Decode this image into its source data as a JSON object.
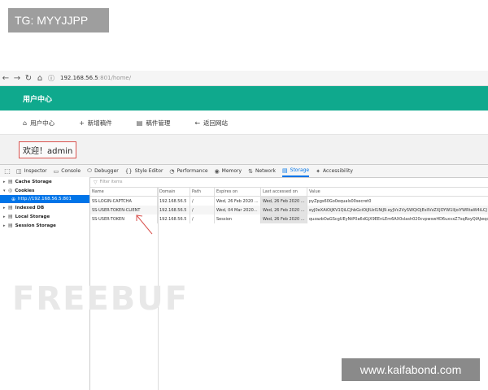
{
  "watermarks": {
    "top_left": "TG: MYYJJPP",
    "bottom_right": "www.kaifabond.com",
    "background_logo": "FREEBUF"
  },
  "browser": {
    "url_host": "192.168.56.5",
    "url_rest": ":801/home/"
  },
  "app": {
    "header_title": "用户中心",
    "menu": [
      {
        "icon": "home-icon",
        "label": "用户中心"
      },
      {
        "icon": "plus-icon",
        "label": "新增稿件"
      },
      {
        "icon": "list-icon",
        "label": "稿件管理"
      },
      {
        "icon": "arrow-left-icon",
        "label": "返回网站"
      }
    ],
    "welcome": "欢迎！admin"
  },
  "devtools": {
    "tabs": [
      {
        "icon": "inspector-icon",
        "label": "Inspector"
      },
      {
        "icon": "console-icon",
        "label": "Console"
      },
      {
        "icon": "debugger-icon",
        "label": "Debugger"
      },
      {
        "icon": "style-editor-icon",
        "label": "Style Editor"
      },
      {
        "icon": "performance-icon",
        "label": "Performance"
      },
      {
        "icon": "memory-icon",
        "label": "Memory"
      },
      {
        "icon": "network-icon",
        "label": "Network"
      },
      {
        "icon": "storage-icon",
        "label": "Storage"
      },
      {
        "icon": "accessibility-icon",
        "label": "Accessibility"
      }
    ],
    "active_tab": "Storage",
    "sidebar": {
      "items": [
        "Cache Storage",
        "Cookies",
        "Indexed DB",
        "Local Storage",
        "Session Storage"
      ],
      "selected_sub": "http://192.168.56.5:801"
    },
    "filter_placeholder": "Filter items",
    "columns": [
      "Name",
      "Domain",
      "Path",
      "Expires on",
      "Last accessed on",
      "Value"
    ],
    "rows": [
      [
        "SS-LOGIN-CAPTCHA",
        "192.168.56.5",
        "/",
        "Wed, 26 Feb 2020 ...",
        "Wed, 26 Feb 2020 ...",
        "pyZpgs60Go0equals00secret0"
      ],
      [
        "SS-USER-TOKEN-CLIENT",
        "192.168.56.5",
        "/",
        "Wed, 04 Mar 2020...",
        "Wed, 26 Feb 2020 ...",
        "eyJ0eXAiOiJKV1QiLCJhbGciOiJIUzI1NiJ9.eyJVc2VySWQiOjEsIlVzZXJOYW1lIjoiYWRtaW4iLCJ"
      ],
      [
        "SS-USER-TOKEN",
        "192.168.56.5",
        "/",
        "Session",
        "Wed, 26 Feb 2020 ...",
        "quzazbOaGScgUEyNtP0a6dGjX9EEnLEm6AX0slash020cvpwswHD6uxvxZ7sqRoyQIAJwqc"
      ]
    ]
  },
  "colors": {
    "header_green": "#0fa98d",
    "active_blue": "#0074e8",
    "welcome_border": "#d9534f"
  }
}
